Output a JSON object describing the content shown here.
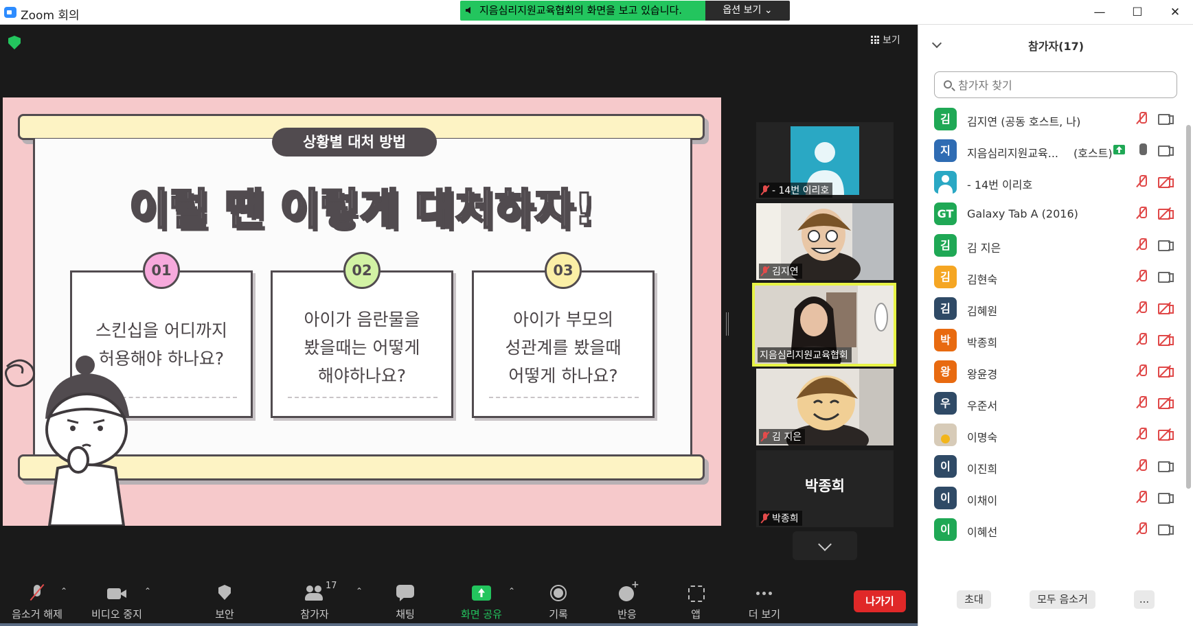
{
  "window": {
    "title": "Zoom 회의",
    "share_banner": "지음심리지원교육협회의 화면을 보고 있습니다.",
    "view_options": "옵션 보기 ⌄",
    "minimize": "—",
    "maximize": "☐",
    "close": "✕"
  },
  "stage": {
    "view_label": "보기"
  },
  "slide": {
    "pill": "상황별 대처 방법",
    "headline": "이럴 땐 이렇게 대처하자!",
    "cards": [
      {
        "num": "01",
        "line1": "스킨십을 어디까지",
        "line2": "허용해야 하나요?",
        "line3": "",
        "color": "#f7a9dc"
      },
      {
        "num": "02",
        "line1": "아이가 음란물을",
        "line2": "봤을때는 어떻게",
        "line3": "해야하나요?",
        "color": "#d2f2a4"
      },
      {
        "num": "03",
        "line1": "아이가 부모의",
        "line2": "성관계를 봤을때",
        "line3": "어떻게 하나요?",
        "color": "#fbefa6"
      }
    ]
  },
  "tiles": [
    {
      "name": "- 14번 이리호",
      "kind": "avatar"
    },
    {
      "name": "김지연",
      "kind": "video"
    },
    {
      "name": "지음심리지원교육협회",
      "kind": "video-active"
    },
    {
      "name": "김 지은",
      "kind": "video"
    },
    {
      "name": "박종희",
      "big_name": "박종희",
      "kind": "name-only"
    }
  ],
  "toolbar": {
    "unmute": "음소거 해제",
    "stop_video": "비디오 중지",
    "security": "보안",
    "participants": "참가자",
    "participants_count": "17",
    "chat": "채팅",
    "share": "화면 공유",
    "record": "기록",
    "reactions": "반응",
    "apps": "앱",
    "more": "더 보기",
    "leave": "나가기"
  },
  "panel": {
    "title": "참가자(17)",
    "search_placeholder": "참가자 찾기",
    "participants": [
      {
        "initial": "김",
        "name": "김지연 (공동 호스트, 나)",
        "role": "",
        "avatar_color": "#1fa855",
        "mic": "muted",
        "cam": "on"
      },
      {
        "initial": "지",
        "name": "지음심리지원교육...",
        "role": "(호스트)",
        "avatar_color": "#2f6cb3",
        "mic": "on",
        "cam": "on",
        "sharing": true
      },
      {
        "initial": "",
        "name": "- 14번 이리호",
        "role": "",
        "avatar_color": "#2aa8c4",
        "mic": "muted",
        "cam": "off",
        "avatar_type": "person"
      },
      {
        "initial": "GT",
        "name": "Galaxy Tab A (2016)",
        "role": "",
        "avatar_color": "#1fa855",
        "mic": "muted",
        "cam": "off"
      },
      {
        "initial": "김",
        "name": "김 지은",
        "role": "",
        "avatar_color": "#1fa855",
        "mic": "muted",
        "cam": "on"
      },
      {
        "initial": "김",
        "name": "김현숙",
        "role": "",
        "avatar_color": "#f5a623",
        "mic": "muted",
        "cam": "on"
      },
      {
        "initial": "김",
        "name": "김혜원",
        "role": "",
        "avatar_color": "#2f4a66",
        "mic": "muted",
        "cam": "off"
      },
      {
        "initial": "박",
        "name": "박종희",
        "role": "",
        "avatar_color": "#e86a10",
        "mic": "muted",
        "cam": "off"
      },
      {
        "initial": "왕",
        "name": "왕윤경",
        "role": "",
        "avatar_color": "#e86a10",
        "mic": "muted",
        "cam": "off"
      },
      {
        "initial": "우",
        "name": "우준서",
        "role": "",
        "avatar_color": "#2f4a66",
        "mic": "muted",
        "cam": "off"
      },
      {
        "initial": "",
        "name": "이명숙",
        "role": "",
        "avatar_color": "#d7cbb8",
        "mic": "muted",
        "cam": "off",
        "avatar_type": "photo"
      },
      {
        "initial": "이",
        "name": "이진희",
        "role": "",
        "avatar_color": "#2f4a66",
        "mic": "muted",
        "cam": "on"
      },
      {
        "initial": "이",
        "name": "이채이",
        "role": "",
        "avatar_color": "#2f4a66",
        "mic": "muted",
        "cam": "on"
      },
      {
        "initial": "이",
        "name": "이혜선",
        "role": "",
        "avatar_color": "#1fa855",
        "mic": "muted",
        "cam": "on"
      }
    ],
    "footer": {
      "invite": "초대",
      "mute_all": "모두 음소거",
      "more": "..."
    }
  }
}
